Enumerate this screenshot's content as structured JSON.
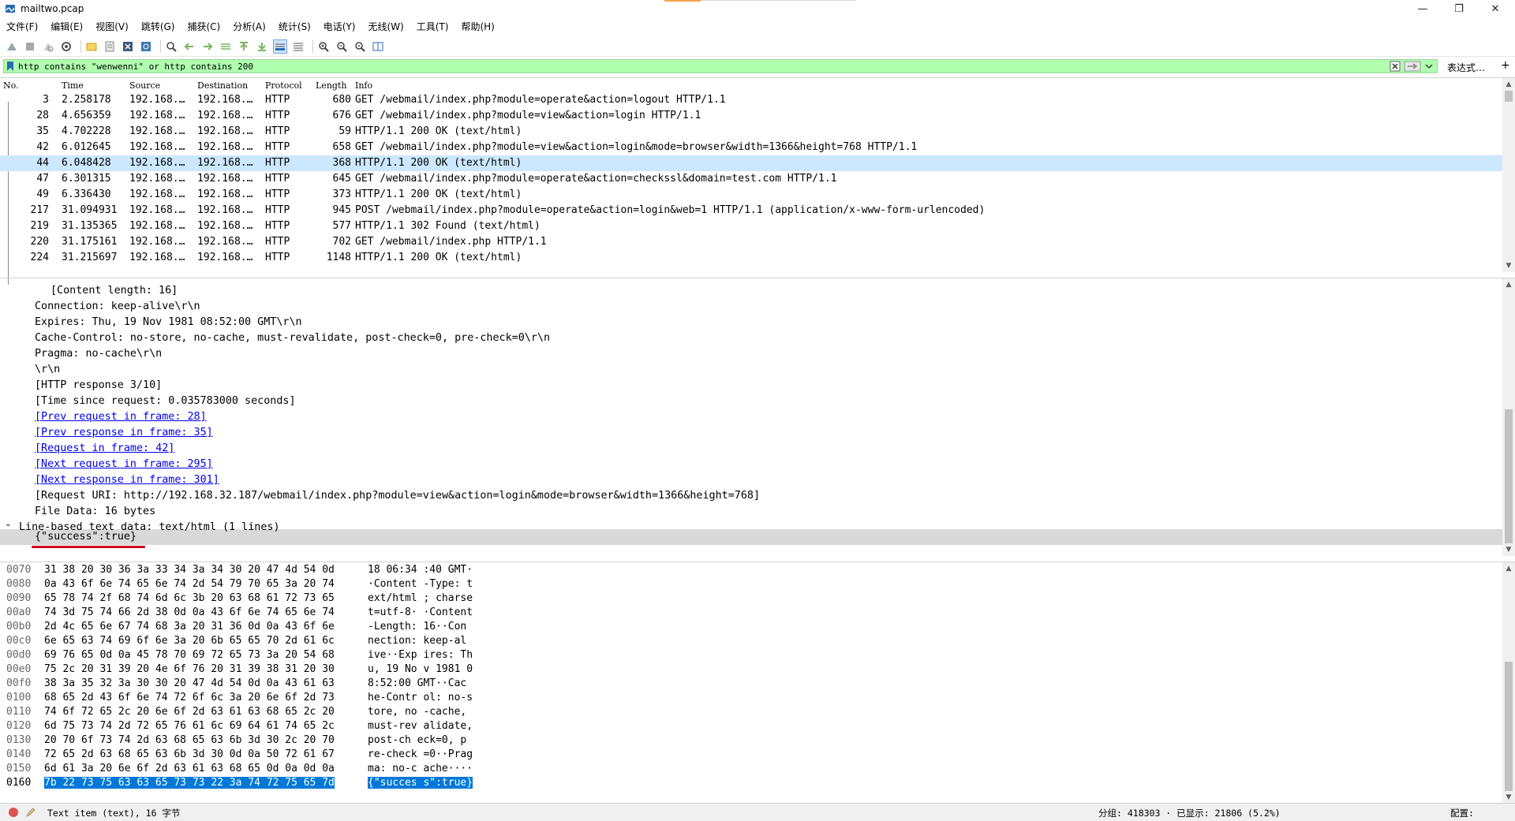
{
  "window": {
    "title": "mailtwo.pcap",
    "minimize_glyph": "—",
    "restore_glyph": "❐",
    "close_glyph": "✕"
  },
  "menu": [
    "文件(F)",
    "编辑(E)",
    "视图(V)",
    "跳转(G)",
    "捕获(C)",
    "分析(A)",
    "统计(S)",
    "电话(Y)",
    "无线(W)",
    "工具(T)",
    "帮助(H)"
  ],
  "toolbar_icons": [
    "shark-start-icon",
    "stop-icon",
    "restart-icon",
    "options-icon",
    "open-file-icon",
    "save-icon",
    "close-file-icon",
    "reload-icon",
    "find-icon",
    "back-icon",
    "forward-icon",
    "goto-icon",
    "first-packet-icon",
    "last-packet-icon",
    "autoscroll-icon",
    "colorize-icon",
    "zoom-in-icon",
    "zoom-out-icon",
    "zoom-reset-icon",
    "resize-columns-icon"
  ],
  "filter": {
    "value": "http contains \"wenwenni\" or http contains 200",
    "expression_label": "表达式…",
    "add_label": "+"
  },
  "packet_list": {
    "columns": [
      "No.",
      "Time",
      "Source",
      "Destination",
      "Protocol",
      "Length",
      "Info"
    ],
    "rows": [
      {
        "no": "3",
        "time": "2.258178",
        "src": "192.168.…",
        "dst": "192.168.…",
        "proto": "HTTP",
        "len": "680",
        "info": "GET /webmail/index.php?module=operate&action=logout HTTP/1.1"
      },
      {
        "no": "28",
        "time": "4.656359",
        "src": "192.168.…",
        "dst": "192.168.…",
        "proto": "HTTP",
        "len": "676",
        "info": "GET /webmail/index.php?module=view&action=login HTTP/1.1"
      },
      {
        "no": "35",
        "time": "4.702228",
        "src": "192.168.…",
        "dst": "192.168.…",
        "proto": "HTTP",
        "len": "59",
        "info": "HTTP/1.1 200 OK  (text/html)"
      },
      {
        "no": "42",
        "time": "6.012645",
        "src": "192.168.…",
        "dst": "192.168.…",
        "proto": "HTTP",
        "len": "658",
        "info": "GET /webmail/index.php?module=view&action=login&mode=browser&width=1366&height=768 HTTP/1.1"
      },
      {
        "no": "44",
        "time": "6.048428",
        "src": "192.168.…",
        "dst": "192.168.…",
        "proto": "HTTP",
        "len": "368",
        "info": "HTTP/1.1 200 OK  (text/html)"
      },
      {
        "no": "47",
        "time": "6.301315",
        "src": "192.168.…",
        "dst": "192.168.…",
        "proto": "HTTP",
        "len": "645",
        "info": "GET /webmail/index.php?module=operate&action=checkssl&domain=test.com HTTP/1.1"
      },
      {
        "no": "49",
        "time": "6.336430",
        "src": "192.168.…",
        "dst": "192.168.…",
        "proto": "HTTP",
        "len": "373",
        "info": "HTTP/1.1 200 OK  (text/html)"
      },
      {
        "no": "217",
        "time": "31.094931",
        "src": "192.168.…",
        "dst": "192.168.…",
        "proto": "HTTP",
        "len": "945",
        "info": "POST /webmail/index.php?module=operate&action=login&web=1 HTTP/1.1  (application/x-www-form-urlencoded)"
      },
      {
        "no": "219",
        "time": "31.135365",
        "src": "192.168.…",
        "dst": "192.168.…",
        "proto": "HTTP",
        "len": "577",
        "info": "HTTP/1.1 302 Found  (text/html)"
      },
      {
        "no": "220",
        "time": "31.175161",
        "src": "192.168.…",
        "dst": "192.168.…",
        "proto": "HTTP",
        "len": "702",
        "info": "GET /webmail/index.php HTTP/1.1"
      },
      {
        "no": "224",
        "time": "31.215697",
        "src": "192.168.…",
        "dst": "192.168.…",
        "proto": "HTTP",
        "len": "1148",
        "info": "HTTP/1.1 200 OK  (text/html)"
      }
    ]
  },
  "details": {
    "lines": [
      {
        "text": "[Content length: 16]",
        "kind": "sub"
      },
      {
        "text": "Connection: keep-alive\\r\\n",
        "kind": "plain"
      },
      {
        "text": "Expires: Thu, 19 Nov 1981 08:52:00 GMT\\r\\n",
        "kind": "plain"
      },
      {
        "text": "Cache-Control: no-store, no-cache, must-revalidate, post-check=0, pre-check=0\\r\\n",
        "kind": "plain"
      },
      {
        "text": "Pragma: no-cache\\r\\n",
        "kind": "plain"
      },
      {
        "text": "\\r\\n",
        "kind": "plain"
      },
      {
        "text": "[HTTP response 3/10]",
        "kind": "plain"
      },
      {
        "text": "[Time since request: 0.035783000 seconds]",
        "kind": "plain"
      },
      {
        "text": "[Prev request in frame: 28]",
        "kind": "link"
      },
      {
        "text": "[Prev response in frame: 35]",
        "kind": "link"
      },
      {
        "text": "[Request in frame: 42]",
        "kind": "link"
      },
      {
        "text": "[Next request in frame: 295]",
        "kind": "link"
      },
      {
        "text": "[Next response in frame: 301]",
        "kind": "link"
      },
      {
        "text": "[Request URI: http://192.168.32.187/webmail/index.php?module=view&action=login&mode=browser&width=1366&height=768]",
        "kind": "plain"
      },
      {
        "text": "File Data: 16 bytes",
        "kind": "plain"
      },
      {
        "text": "Line-based text data: text/html (1 lines)",
        "kind": "top"
      },
      {
        "text": "{\"success\":true}",
        "kind": "plain"
      }
    ],
    "expander_glyph": "⌄"
  },
  "bytes": [
    {
      "off": "0070",
      "hex": "31 38 20 30 36 3a 33 34  3a 34 30 20 47 4d 54 0d",
      "asc": "18 06:34 :40 GMT·"
    },
    {
      "off": "0080",
      "hex": "0a 43 6f 6e 74 65 6e 74  2d 54 79 70 65 3a 20 74",
      "asc": "·Content -Type: t"
    },
    {
      "off": "0090",
      "hex": "65 78 74 2f 68 74 6d 6c  3b 20 63 68 61 72 73 65",
      "asc": "ext/html ; charse"
    },
    {
      "off": "00a0",
      "hex": "74 3d 75 74 66 2d 38 0d  0a 43 6f 6e 74 65 6e 74",
      "asc": "t=utf-8· ·Content"
    },
    {
      "off": "00b0",
      "hex": "2d 4c 65 6e 67 74 68 3a  20 31 36 0d 0a 43 6f 6e",
      "asc": "-Length:  16··Con"
    },
    {
      "off": "00c0",
      "hex": "6e 65 63 74 69 6f 6e 3a  20 6b 65 65 70 2d 61 6c",
      "asc": "nection:  keep-al"
    },
    {
      "off": "00d0",
      "hex": "69 76 65 0d 0a 45 78 70  69 72 65 73 3a 20 54 68",
      "asc": "ive··Exp ires: Th"
    },
    {
      "off": "00e0",
      "hex": "75 2c 20 31 39 20 4e 6f  76 20 31 39 38 31 20 30",
      "asc": "u, 19 No v 1981 0"
    },
    {
      "off": "00f0",
      "hex": "38 3a 35 32 3a 30 30 20  47 4d 54 0d 0a 43 61 63",
      "asc": "8:52:00  GMT··Cac"
    },
    {
      "off": "0100",
      "hex": "68 65 2d 43 6f 6e 74 72  6f 6c 3a 20 6e 6f 2d 73",
      "asc": "he-Contr ol: no-s"
    },
    {
      "off": "0110",
      "hex": "74 6f 72 65 2c 20 6e 6f  2d 63 61 63 68 65 2c 20",
      "asc": "tore, no -cache,"
    },
    {
      "off": "0120",
      "hex": "6d 75 73 74 2d 72 65 76  61 6c 69 64 61 74 65 2c",
      "asc": "must-rev alidate,"
    },
    {
      "off": "0130",
      "hex": "20 70 6f 73 74 2d 63 68  65 63 6b 3d 30 2c 20 70",
      "asc": " post-ch eck=0, p"
    },
    {
      "off": "0140",
      "hex": "72 65 2d 63 68 65 63 6b  3d 30 0d 0a 50 72 61 67",
      "asc": "re-check =0··Prag"
    },
    {
      "off": "0150",
      "hex": "6d 61 3a 20 6e 6f 2d 63  61 63 68 65 0d 0a 0d 0a",
      "asc": "ma: no-c ache····"
    },
    {
      "off": "0160",
      "hex": "7b 22 73 75 63 63 65 73  73 22 3a 74 72 75 65 7d",
      "asc": "{\"succes s\":true}"
    }
  ],
  "status": {
    "item_text": "Text item (text), 16 字节",
    "packets": "分组: 418303 · 已显示: 21806 (5.2%)",
    "profile": "配置: Default"
  },
  "colors": {
    "filter_valid": "#afffaf",
    "selected_row": "#cce8ff",
    "hex_highlight": "#0078d7",
    "annotation_red": "#d0021b"
  }
}
